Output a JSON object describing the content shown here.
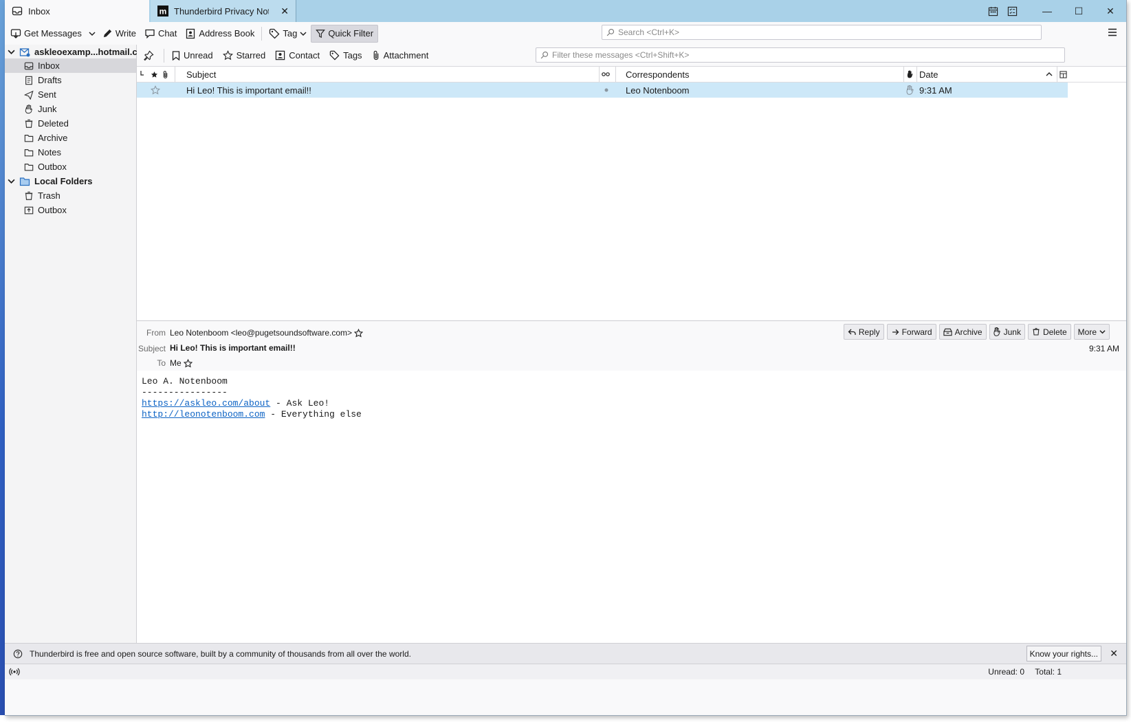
{
  "tabs": [
    {
      "title": "Inbox",
      "icon": "inbox-icon"
    },
    {
      "title": "Thunderbird Privacy Notice",
      "icon": "mozilla-m-icon"
    }
  ],
  "toolbar": {
    "get_messages": "Get Messages",
    "write": "Write",
    "chat": "Chat",
    "address_book": "Address Book",
    "tag": "Tag",
    "quick_filter": "Quick Filter",
    "search_placeholder": "Search <Ctrl+K>"
  },
  "folders": {
    "account": "askleoexamp...hotmail.com",
    "account_items": [
      "Inbox",
      "Drafts",
      "Sent",
      "Junk",
      "Deleted",
      "Archive",
      "Notes",
      "Outbox"
    ],
    "local": "Local Folders",
    "local_items": [
      "Trash",
      "Outbox"
    ]
  },
  "quick_filter": {
    "unread": "Unread",
    "starred": "Starred",
    "contact": "Contact",
    "tags": "Tags",
    "attachment": "Attachment",
    "filter_placeholder": "Filter these messages <Ctrl+Shift+K>"
  },
  "columns": {
    "subject": "Subject",
    "correspondents": "Correspondents",
    "date": "Date"
  },
  "messages": [
    {
      "subject": "Hi Leo! This is important email!!",
      "correspondent": "Leo Notenboom",
      "date": "9:31 AM"
    }
  ],
  "header": {
    "from_label": "From",
    "from_value": "Leo Notenboom <leo@pugetsoundsoftware.com>",
    "subject_label": "Subject",
    "subject_value": "Hi Leo! This is important email!!",
    "to_label": "To",
    "to_value": "Me",
    "time": "9:31 AM",
    "buttons": {
      "reply": "Reply",
      "forward": "Forward",
      "archive": "Archive",
      "junk": "Junk",
      "delete": "Delete",
      "more": "More"
    }
  },
  "body": {
    "line1": "Leo A. Notenboom",
    "line2": "----------------",
    "link1": "https://askleo.com/about",
    "link1_suffix": " - Ask Leo!",
    "link2": "http://leonotenboom.com",
    "link2_suffix": " - Everything else"
  },
  "notification": {
    "text": "Thunderbird is free and open source software, built by a community of thousands from all over the world.",
    "button": "Know your rights..."
  },
  "status": {
    "unread": "Unread: 0",
    "total": "Total: 1"
  },
  "colors": {
    "titlebar": "#a9d1e8",
    "selected_row": "#cde8f8",
    "link": "#0b62c4"
  }
}
